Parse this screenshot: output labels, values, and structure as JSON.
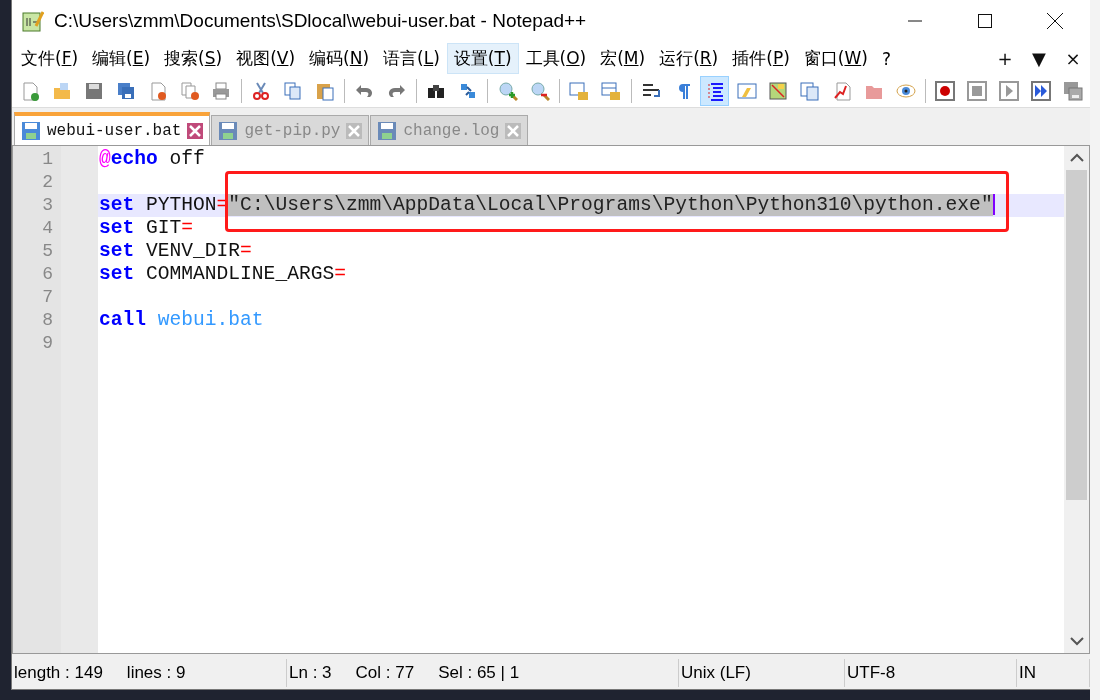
{
  "window": {
    "title": "C:\\Users\\zmm\\Documents\\SDlocal\\webui-user.bat - Notepad++"
  },
  "menu_bar": {
    "items": [
      {
        "label": "文件(F)",
        "selected": false
      },
      {
        "label": "编辑(E)",
        "selected": false
      },
      {
        "label": "搜索(S)",
        "selected": false
      },
      {
        "label": "视图(V)",
        "selected": false
      },
      {
        "label": "编码(N)",
        "selected": false
      },
      {
        "label": "语言(L)",
        "selected": false
      },
      {
        "label": "设置(T)",
        "selected": true
      },
      {
        "label": "工具(O)",
        "selected": false
      },
      {
        "label": "宏(M)",
        "selected": false
      },
      {
        "label": "运行(R)",
        "selected": false
      },
      {
        "label": "插件(P)",
        "selected": false
      },
      {
        "label": "窗口(W)",
        "selected": false
      },
      {
        "label": "?",
        "selected": false
      }
    ],
    "right_controls": [
      "+",
      "▼",
      "×"
    ]
  },
  "toolbar": [
    {
      "pressed": false
    },
    {
      "pressed": false
    },
    {
      "pressed": false
    },
    {
      "pressed": false
    },
    {
      "pressed": false
    },
    {
      "pressed": false
    },
    {
      "pressed": false
    },
    {
      "pressed": false
    },
    {
      "pressed": false
    },
    {
      "pressed": false
    },
    {
      "pressed": false
    },
    {
      "pressed": false
    },
    {
      "pressed": false
    },
    {
      "pressed": false
    },
    {
      "pressed": false
    },
    {
      "pressed": false
    },
    {
      "pressed": false
    },
    {
      "pressed": false
    },
    {
      "pressed": false
    },
    {
      "pressed": false
    },
    {
      "pressed": true
    },
    {
      "pressed": false
    },
    {
      "pressed": false
    },
    {
      "pressed": false
    },
    {
      "pressed": false
    },
    {
      "pressed": false
    },
    {
      "pressed": false
    },
    {
      "pressed": false
    },
    {
      "pressed": false
    },
    {
      "pressed": false
    },
    {
      "pressed": false
    },
    {
      "pressed": false
    }
  ],
  "tabs": [
    {
      "label": "webui-user.bat",
      "selected": true
    },
    {
      "label": "get-pip.py",
      "selected": false
    },
    {
      "label": "change.log",
      "selected": false
    }
  ],
  "editor": {
    "lines": [
      {
        "number": "1",
        "current": false,
        "tokens": [
          {
            "kind": "at",
            "text": "@"
          },
          {
            "kind": "keyword",
            "text": "echo"
          },
          {
            "kind": "plain",
            "text": " off"
          }
        ]
      },
      {
        "number": "2",
        "current": false
      },
      {
        "number": "3",
        "current": true,
        "marked": true,
        "tokens": [
          {
            "kind": "keyword",
            "text": "set"
          },
          {
            "kind": "plain",
            "text": " PYTHON"
          },
          {
            "kind": "operator",
            "text": "="
          },
          {
            "kind": "selection",
            "text": "\"C:\\Users\\zmm\\AppData\\Local\\Programs\\Python\\Python310\\python.exe\""
          }
        ]
      },
      {
        "number": "4",
        "current": false,
        "tokens": [
          {
            "kind": "keyword",
            "text": "set"
          },
          {
            "kind": "plain",
            "text": " GIT"
          },
          {
            "kind": "operator",
            "text": "="
          }
        ]
      },
      {
        "number": "5",
        "current": false,
        "tokens": [
          {
            "kind": "keyword",
            "text": "set"
          },
          {
            "kind": "plain",
            "text": " VENV_DIR"
          },
          {
            "kind": "operator",
            "text": "="
          }
        ]
      },
      {
        "number": "6",
        "current": false,
        "tokens": [
          {
            "kind": "keyword",
            "text": "set"
          },
          {
            "kind": "plain",
            "text": " COMMANDLINE_ARGS"
          },
          {
            "kind": "operator",
            "text": "="
          }
        ]
      },
      {
        "number": "7",
        "current": false
      },
      {
        "number": "8",
        "current": false,
        "tokens": [
          {
            "kind": "keyword",
            "text": "call"
          },
          {
            "kind": "command",
            "text": " webui.bat"
          }
        ]
      },
      {
        "number": "9",
        "current": false
      }
    ]
  },
  "status_bar": [
    {
      "items": [
        "length : 149",
        "lines : 9"
      ]
    },
    {
      "items": [
        "Ln : 3",
        "Col : 77",
        "Sel : 65 | 1"
      ]
    },
    {
      "items": [
        "Unix (LF)"
      ]
    },
    {
      "items": [
        "UTF-8"
      ]
    },
    {
      "items": [
        "IN"
      ]
    }
  ]
}
